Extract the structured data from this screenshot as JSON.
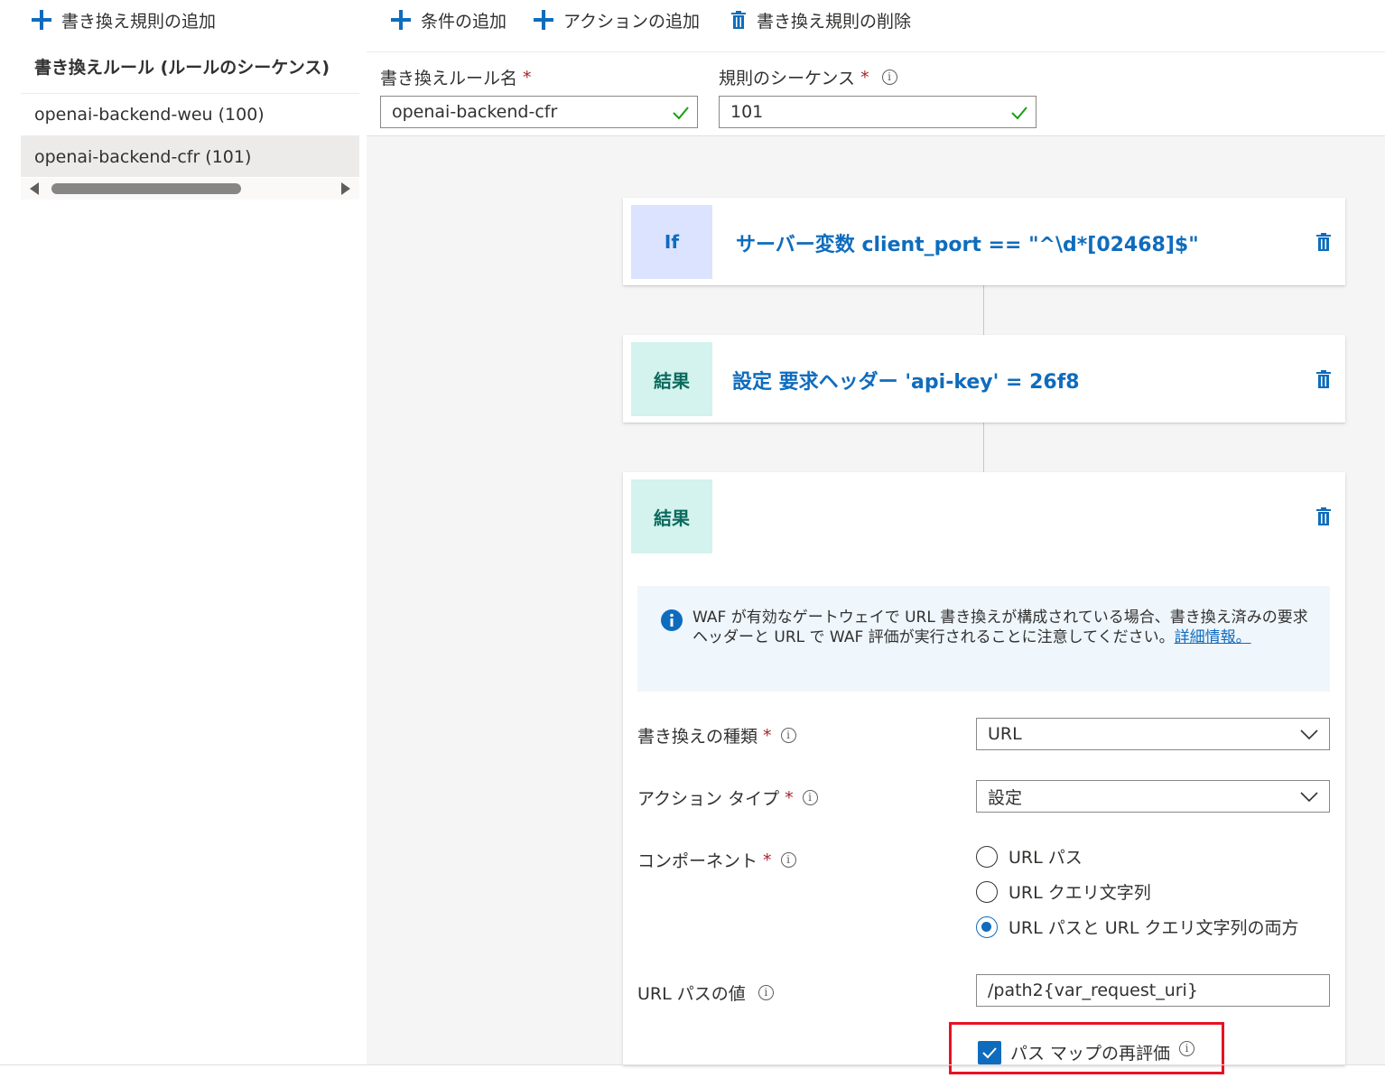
{
  "left_panel": {
    "add_rule_label": "書き換え規則の追加",
    "column_header": "書き換えルール (ルールのシーケンス)",
    "rules": [
      {
        "label": "openai-backend-weu (100)",
        "selected": false
      },
      {
        "label": "openai-backend-cfr (101)",
        "selected": true
      }
    ]
  },
  "toolbar": {
    "add_condition": "条件の追加",
    "add_action": "アクションの追加",
    "delete_rule": "書き換え規則の削除"
  },
  "rule_form": {
    "name_label": "書き換えルール名",
    "name_value": "openai-backend-cfr",
    "sequence_label": "規則のシーケンス",
    "sequence_value": "101",
    "required_mark": "*"
  },
  "cards": {
    "condition": {
      "badge": "If",
      "title": "サーバー変数 client_port == \"^\\d*[02468]$\""
    },
    "result1": {
      "badge": "結果",
      "title": "設定 要求ヘッダー 'api-key' = 26f8"
    },
    "result2": {
      "badge": "結果",
      "info_text": "WAF が有効なゲートウェイで URL 書き換えが構成されている場合、書き換え済みの要求ヘッダーと URL で WAF 評価が実行されることに注意してください。",
      "info_link": "詳細情報。",
      "rewrite_type_label": "書き換えの種類",
      "rewrite_type_value": "URL",
      "action_type_label": "アクション タイプ",
      "action_type_value": "設定",
      "component_label": "コンポーネント",
      "component_options": [
        "URL パス",
        "URL クエリ文字列",
        "URL パスと URL クエリ文字列の両方"
      ],
      "component_selected": 2,
      "url_path_label": "URL パスの値",
      "url_path_value": "/path2{var_request_uri}",
      "reevaluate_label": "パス マップの再評価",
      "reevaluate_checked": true
    }
  },
  "colors": {
    "accent": "#0f6cbd",
    "if_badge": "#dbe3ff",
    "result_badge": "#d4f2ee",
    "highlight": "#e81123",
    "required": "#a4262c",
    "valid_check": "#13a10e"
  }
}
